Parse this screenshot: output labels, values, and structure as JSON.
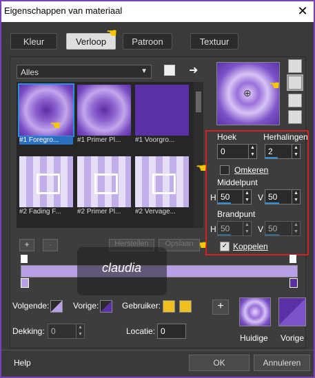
{
  "window": {
    "title": "Eigenschappen van materiaal",
    "close_icon": "close-icon"
  },
  "tabs": [
    {
      "label": "Kleur"
    },
    {
      "label": "Verloop"
    },
    {
      "label": "Patroon"
    },
    {
      "label": "Textuur"
    }
  ],
  "category": {
    "value": "Alles"
  },
  "thumbnails": [
    {
      "label": "#1 Foregro..."
    },
    {
      "label": "#1 Primer Pl..."
    },
    {
      "label": "#1 Voorgro..."
    },
    {
      "label": "#2 Fading F..."
    },
    {
      "label": "#2 Primer Pl..."
    },
    {
      "label": "#2 Vervage..."
    }
  ],
  "controls": {
    "hoek_label": "Hoek",
    "hoek_value": "0",
    "herhalingen_label": "Herhalingen",
    "herhalingen_value": "2",
    "omkeren_label": "Omkeren",
    "middelpunt_label": "Middelpunt",
    "h_label": "H",
    "h_value": "50",
    "v_label": "V",
    "v_value": "50",
    "brandpunt_label": "Brandpunt",
    "bh_label": "H",
    "bh_value": "50",
    "bv_label": "V",
    "bv_value": "50",
    "koppelen_label": "Koppelen"
  },
  "editor": {
    "plus_label": "+",
    "minus_label": "-",
    "herstellen_label": "Herstellen",
    "opslaan_label": "Opslaan"
  },
  "watermark": {
    "text": "claudia"
  },
  "bottom": {
    "volgende_label": "Volgende:",
    "vorige_label": "Vorige:",
    "gebruiker_label": "Gebruiker:",
    "dekking_label": "Dekking:",
    "dekking_value": "0",
    "locatie_label": "Locatie:",
    "locatie_value": "0",
    "add_label": "+",
    "huidige_label": "Huidige",
    "vorige2_label": "Vorige"
  },
  "footer": {
    "help": "Help",
    "ok": "OK",
    "annuleren": "Annuleren"
  },
  "colors": {
    "accent": "#2a8fe0",
    "purple": "#5b2fa5",
    "highlight": "#d42020"
  }
}
